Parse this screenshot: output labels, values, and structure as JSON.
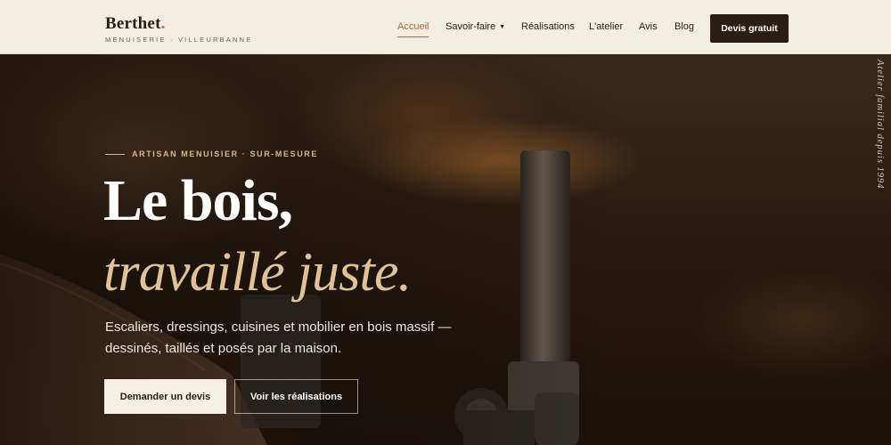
{
  "header": {
    "logo_text": "Berthet",
    "logo_dot": ".",
    "tagline": "MENUISERIE · VILLEURBANNE",
    "nav": [
      {
        "label": "Accueil",
        "active": true
      },
      {
        "label": "Savoir-faire",
        "has_dropdown": true
      },
      {
        "label": "Réalisations"
      },
      {
        "label": "L'atelier"
      },
      {
        "label": "Avis"
      },
      {
        "label": "Blog"
      }
    ],
    "cta_label": "Devis gratuit"
  },
  "hero": {
    "eyebrow": "ARTISAN MENUISIER · SUR-MESURE",
    "headline_line1": "Le bois,",
    "headline_line2": "travaillé juste.",
    "subcopy": "Escaliers, dressings, cuisines et mobilier en bois massif — dessinés, taillés et posés par la maison.",
    "primary_button": "Demander un devis",
    "secondary_button": "Voir les réalisations",
    "vertical_caption": "Atelier familial depuis 1994"
  },
  "icons": {
    "dropdown": "caret-down-icon"
  },
  "colors": {
    "header_bg": "#f3ede4",
    "brand_dark": "#2a1d14",
    "accent": "#a56a35",
    "headline_italic": "#e2c199",
    "eyebrow": "#d8b58c"
  }
}
